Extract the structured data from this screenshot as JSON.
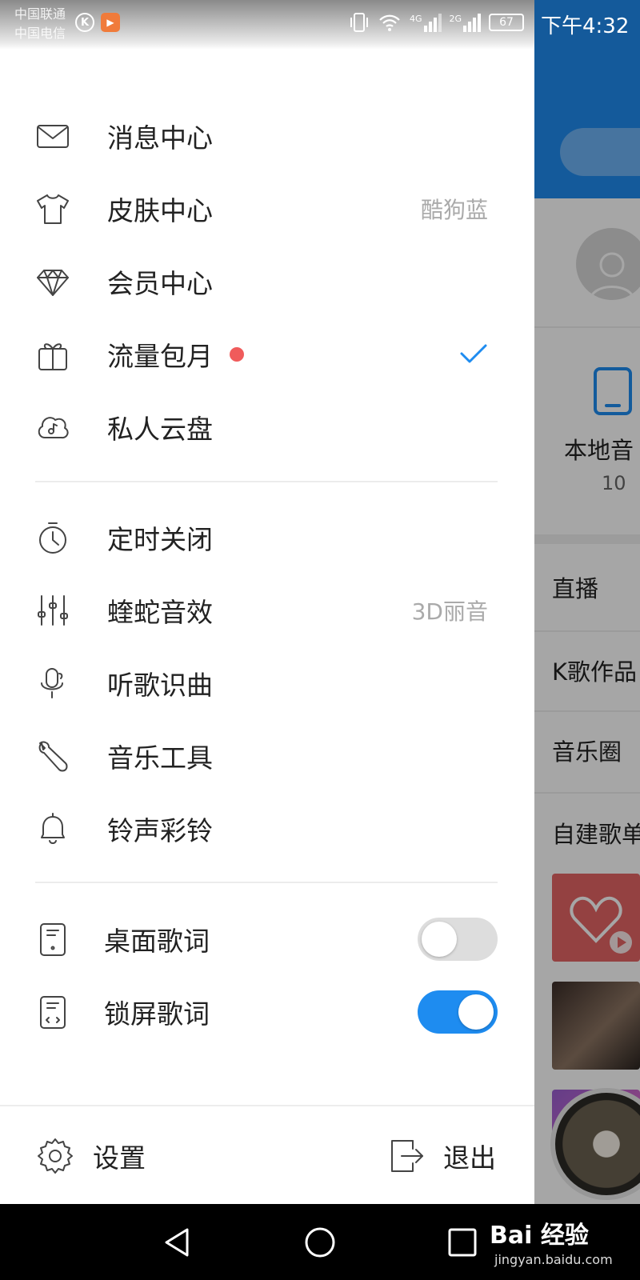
{
  "status_bar": {
    "carrier_1": "中国联通",
    "carrier_2": "中国电信",
    "net_1": "4G",
    "net_2": "2G",
    "battery": "67",
    "time": "下午4:32"
  },
  "drawer": {
    "group_1": [
      {
        "label": "消息中心",
        "icon": "envelope-icon"
      },
      {
        "label": "皮肤中心",
        "icon": "tshirt-icon",
        "hint": "酷狗蓝"
      },
      {
        "label": "会员中心",
        "icon": "diamond-icon"
      },
      {
        "label": "流量包月",
        "icon": "gift-icon",
        "badge": "red-dot",
        "checked": true
      },
      {
        "label": "私人云盘",
        "icon": "cloud-music-icon"
      }
    ],
    "group_2": [
      {
        "label": "定时关闭",
        "icon": "timer-icon"
      },
      {
        "label": "蝰蛇音效",
        "icon": "equalizer-icon",
        "hint": "3D丽音"
      },
      {
        "label": "听歌识曲",
        "icon": "microphone-icon"
      },
      {
        "label": "音乐工具",
        "icon": "wrench-icon"
      },
      {
        "label": "铃声彩铃",
        "icon": "bell-icon"
      }
    ],
    "group_3": [
      {
        "label": "桌面歌词",
        "icon": "desktop-lyrics-icon",
        "toggle": false
      },
      {
        "label": "锁屏歌词",
        "icon": "lockscreen-lyrics-icon",
        "toggle": true
      }
    ],
    "footer": {
      "settings_label": "设置",
      "logout_label": "退出"
    }
  },
  "background_app": {
    "local_music_label": "本地音",
    "local_music_count": "10",
    "rows": [
      "直播",
      "K歌作品",
      "音乐圈",
      "自建歌单"
    ]
  },
  "watermark": {
    "text": "Bai 经验",
    "url": "jingyan.baidu.com"
  },
  "colors": {
    "accent": "#1e8cf0",
    "badge": "#f05b5b",
    "hint_text": "#aaaaaa"
  }
}
